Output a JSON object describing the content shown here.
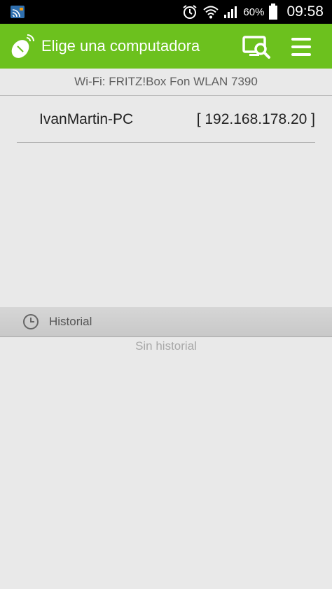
{
  "status_bar": {
    "battery_percent": "60%",
    "time": "09:58",
    "icons": [
      "cast-icon",
      "alarm-icon",
      "wifi-icon",
      "signal-icon",
      "battery-icon"
    ]
  },
  "action_bar": {
    "title": "Elige una computadora",
    "background_color": "#6cc11e",
    "icons": [
      "app-logo-icon",
      "search-computer-icon",
      "menu-icon"
    ]
  },
  "network": {
    "label": "Wi-Fi: FRITZ!Box Fon WLAN 7390"
  },
  "computers": [
    {
      "name": "IvanMartin-PC",
      "ip": "[ 192.168.178.20 ]"
    }
  ],
  "history": {
    "header_label": "Historial",
    "empty_text": "Sin historial",
    "icon": "clock-icon"
  }
}
